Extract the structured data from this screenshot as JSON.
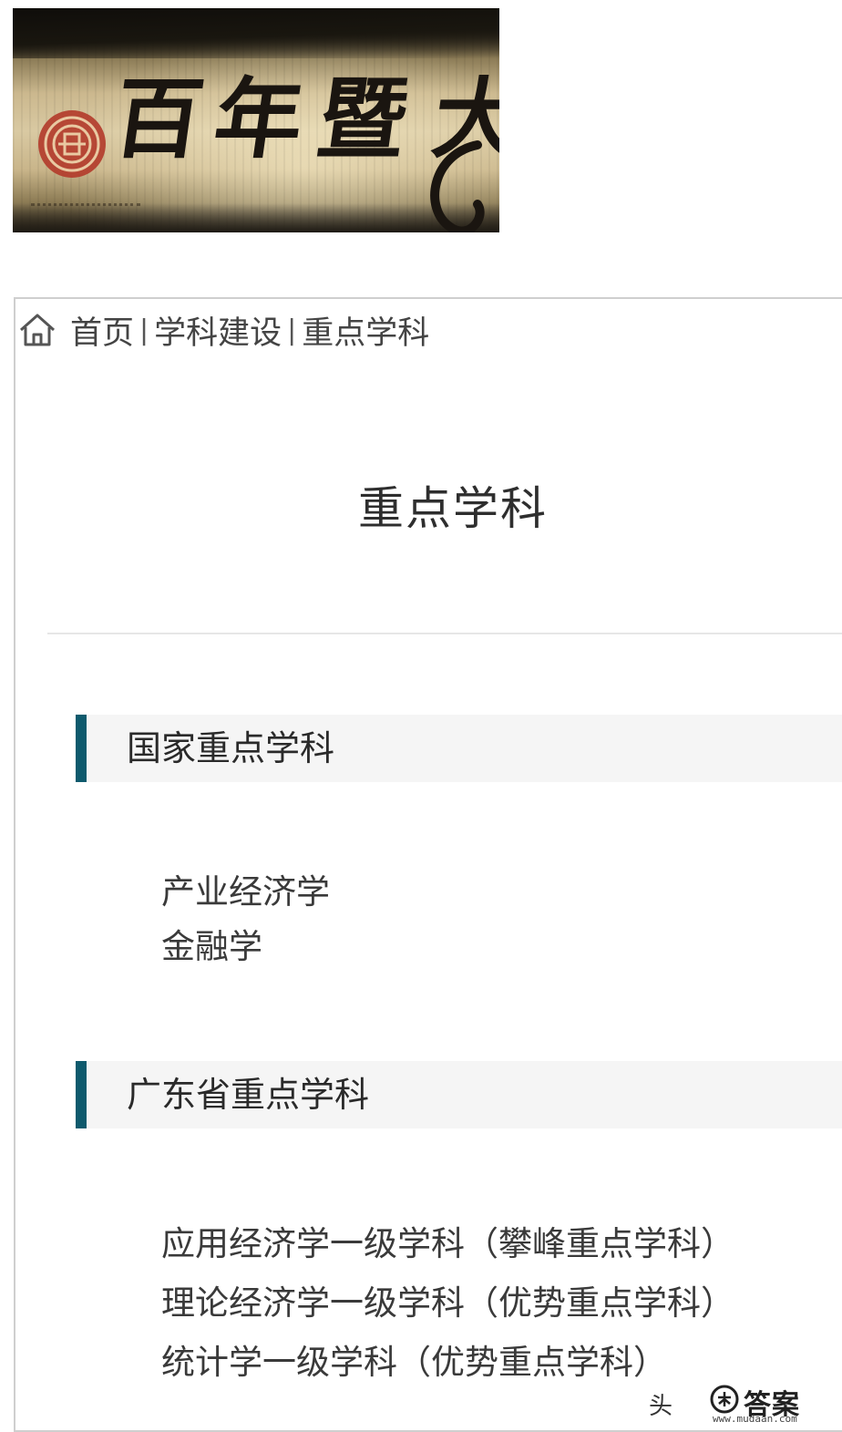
{
  "banner": {
    "calligraphy": [
      "百",
      "年",
      "暨",
      "大"
    ],
    "seal_color": "#b23a2a"
  },
  "breadcrumb": {
    "home": "首页",
    "separator": "|",
    "level1": "学科建设",
    "level2": "重点学科"
  },
  "page_title": "重点学科",
  "accent_color": "#0e5a6d",
  "sections": [
    {
      "title": "国家重点学科",
      "items": [
        "产业经济学",
        "金融学"
      ]
    },
    {
      "title": "广东省重点学科",
      "items": [
        "应用经济学一级学科（攀峰重点学科）",
        "理论经济学一级学科（优势重点学科）",
        "统计学一级学科（优势重点学科）"
      ]
    }
  ],
  "watermark": {
    "glyph": "头",
    "text": "答案",
    "url": "www.mudaan.com"
  }
}
